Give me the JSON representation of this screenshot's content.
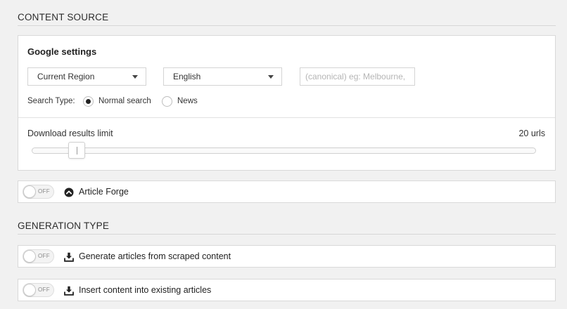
{
  "content_source": {
    "title": "CONTENT SOURCE",
    "google": {
      "title": "Google settings",
      "region_select": "Current Region",
      "language_select": "English",
      "location_placeholder": "(canonical) eg: Melbourne,",
      "search_type_label": "Search Type:",
      "search_types": [
        {
          "label": "Normal search",
          "checked": true
        },
        {
          "label": "News",
          "checked": false
        }
      ],
      "download_limit_label": "Download results limit",
      "download_limit_value": "20 urls",
      "download_limit_fraction": 0.075
    },
    "article_forge": {
      "toggle": "OFF",
      "label": "Article Forge",
      "icon": "chevron-up-circle-icon"
    }
  },
  "generation_type": {
    "title": "GENERATION TYPE",
    "options": [
      {
        "toggle": "OFF",
        "label": "Generate articles from scraped content",
        "icon": "download-icon"
      },
      {
        "toggle": "OFF",
        "label": "Insert content into existing articles",
        "icon": "download-icon"
      }
    ]
  }
}
